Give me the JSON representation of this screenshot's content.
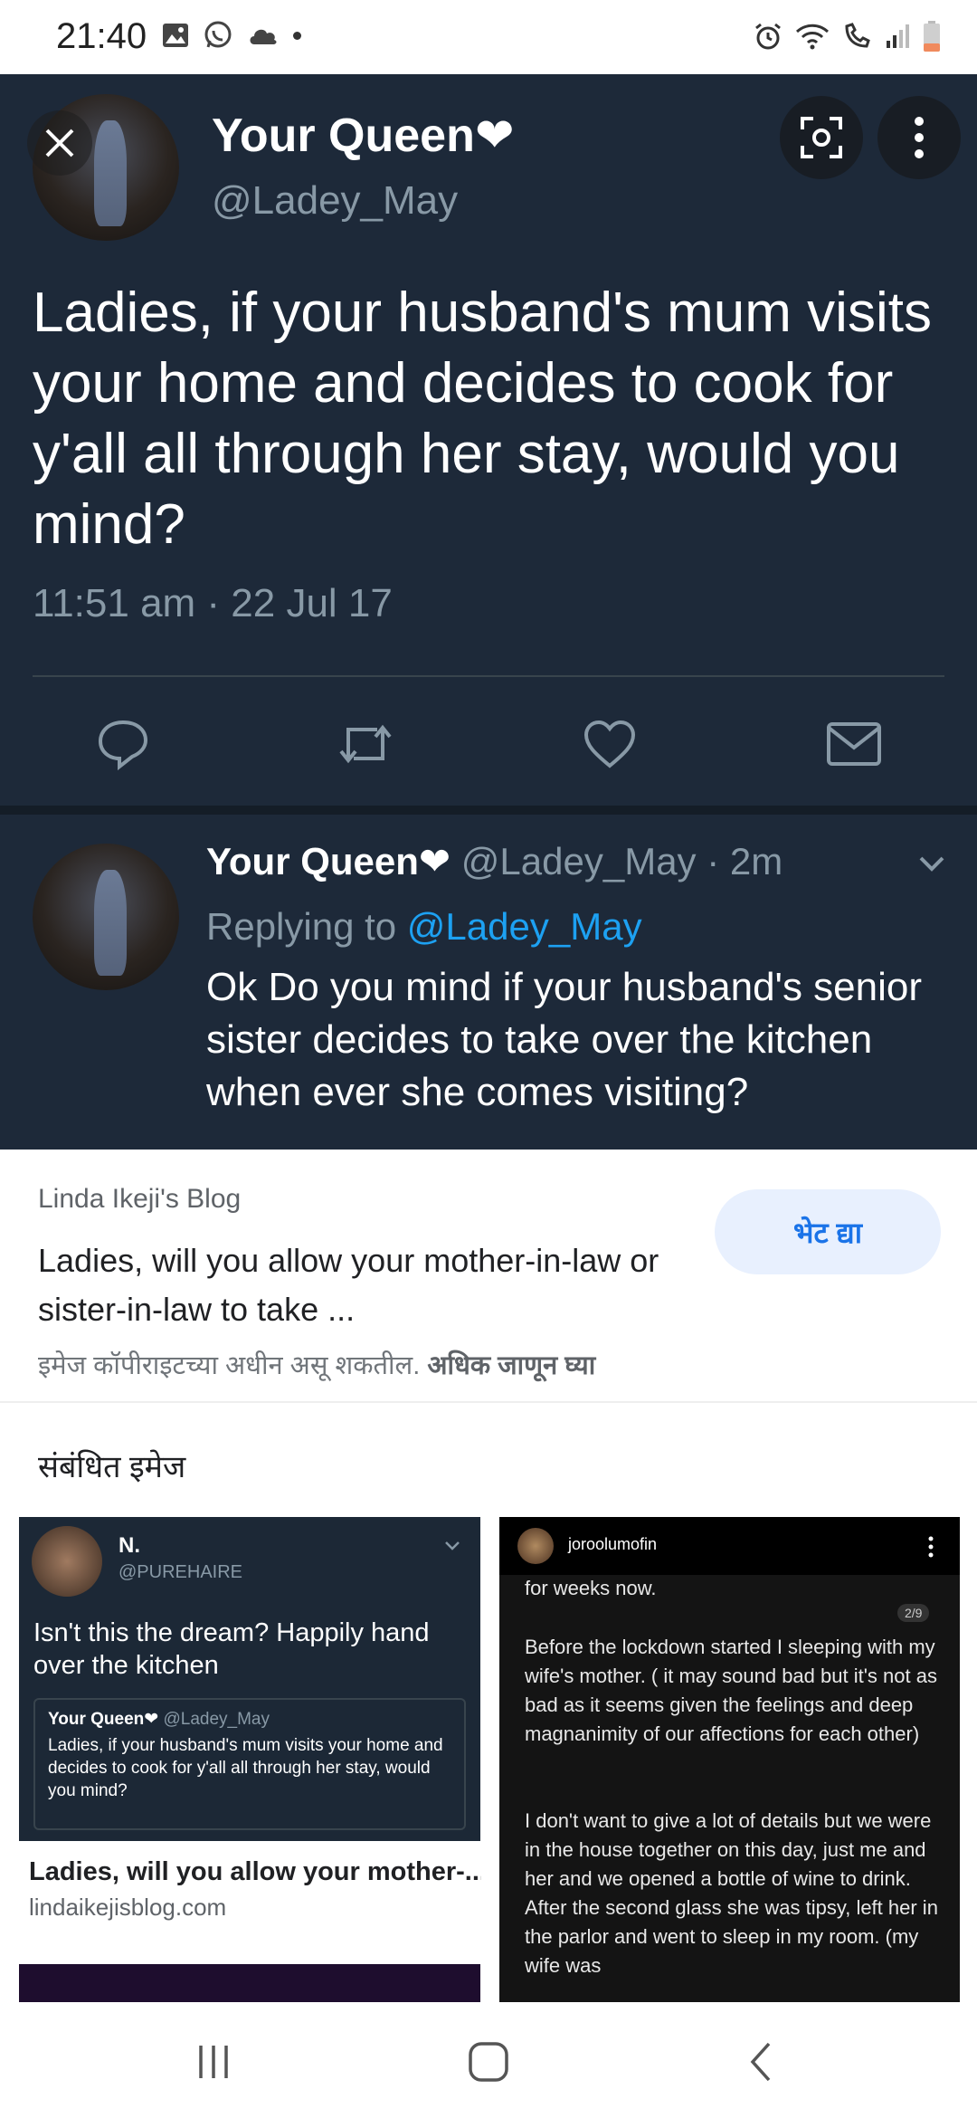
{
  "status_bar": {
    "time": "21:40"
  },
  "tweet": {
    "name": "Your Queen❤",
    "handle": "@Ladey_May",
    "text": "Ladies, if your husband's mum visits your home and decides to cook for y'all all through her stay, would you mind?",
    "timestamp": "11:51 am · 22 Jul 17"
  },
  "reply": {
    "name": "Your Queen❤",
    "meta": "@Ladey_May · 2m",
    "replying_prefix": "Replying to ",
    "replying_mention": "@Ladey_May",
    "text": "Ok Do you mind if your husband's senior sister decides to take over the kitchen when ever she comes visiting?"
  },
  "source": {
    "site": "Linda Ikeji's Blog",
    "title": "Ladies, will you allow your mother-in-law or sister-in-law to take ...",
    "visit_label": "भेट द्या",
    "copyright_text": "इमेज कॉपीराइटच्या अधीन असू शकतील.",
    "learn_more": "अधिक जाणून घ्या"
  },
  "related": {
    "heading": "संबंधित इमेज",
    "items": [
      {
        "inner_name": "N.",
        "inner_handle": "@PUREHAIRE",
        "inner_text": "Isn't this the dream? Happily hand over the kitchen",
        "quote_name": "Your Queen❤",
        "quote_handle": "@Ladey_May",
        "quote_text": "Ladies, if your husband's mum visits your home and decides to cook for y'all all through her stay, would you mind?",
        "caption": "Ladies, will you allow your mother-...",
        "domain": "lindaikejisblog.com"
      },
      {
        "inner_user": "joroolumofin",
        "page_indicator": "2/9",
        "line1": "for weeks now.",
        "para1": "Before the lockdown started I sleeping with my wife's mother. ( it may sound bad but it's not as bad as it seems given the feelings and deep magnanimity of our affections for each other)",
        "para2": "I don't want to give a lot of details but we were in the house together on this day, just me and her and we opened a bottle of wine to drink. After the second glass she was tipsy, left her in the parlor and went to sleep in my room.  (my wife was"
      }
    ]
  }
}
